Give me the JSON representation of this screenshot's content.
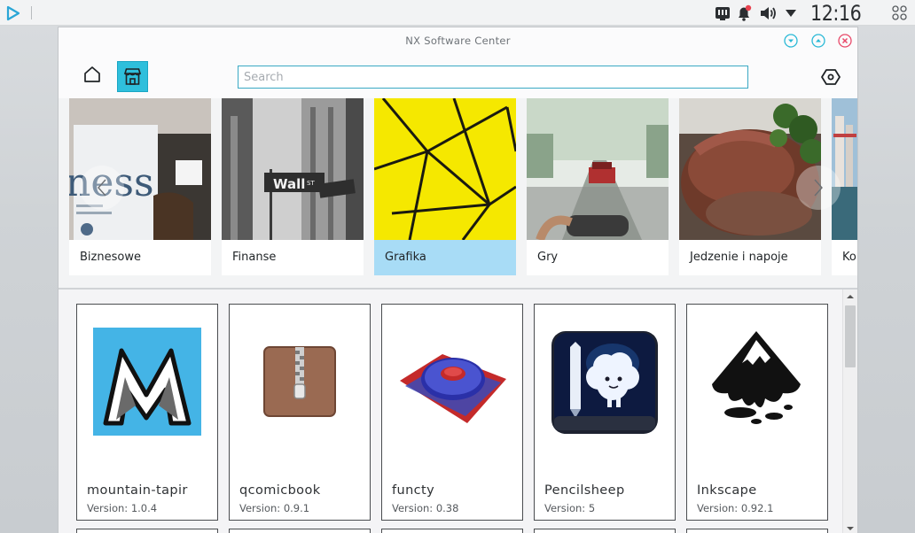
{
  "panel": {
    "clock": "12:16"
  },
  "window": {
    "title": "NX Software Center",
    "search_placeholder": "Search"
  },
  "categories": [
    {
      "label": "Biznesowe"
    },
    {
      "label": "Finanse"
    },
    {
      "label": "Grafika"
    },
    {
      "label": "Gry"
    },
    {
      "label": "Jedzenie i napoje"
    },
    {
      "label": "Ko"
    }
  ],
  "apps": [
    {
      "name": "mountain-tapir",
      "version": "Version: 1.0.4"
    },
    {
      "name": "qcomicbook",
      "version": "Version: 0.9.1"
    },
    {
      "name": "functy",
      "version": "Version: 0.38"
    },
    {
      "name": "Pencilsheep",
      "version": "Version: 5"
    },
    {
      "name": "Inkscape",
      "version": "Version: 0.92.1"
    }
  ],
  "colors": {
    "accent": "#2fbfdc",
    "selected_category": "#a8dcf6",
    "close": "#e84a6a",
    "minimize": "#2ab9d6"
  }
}
